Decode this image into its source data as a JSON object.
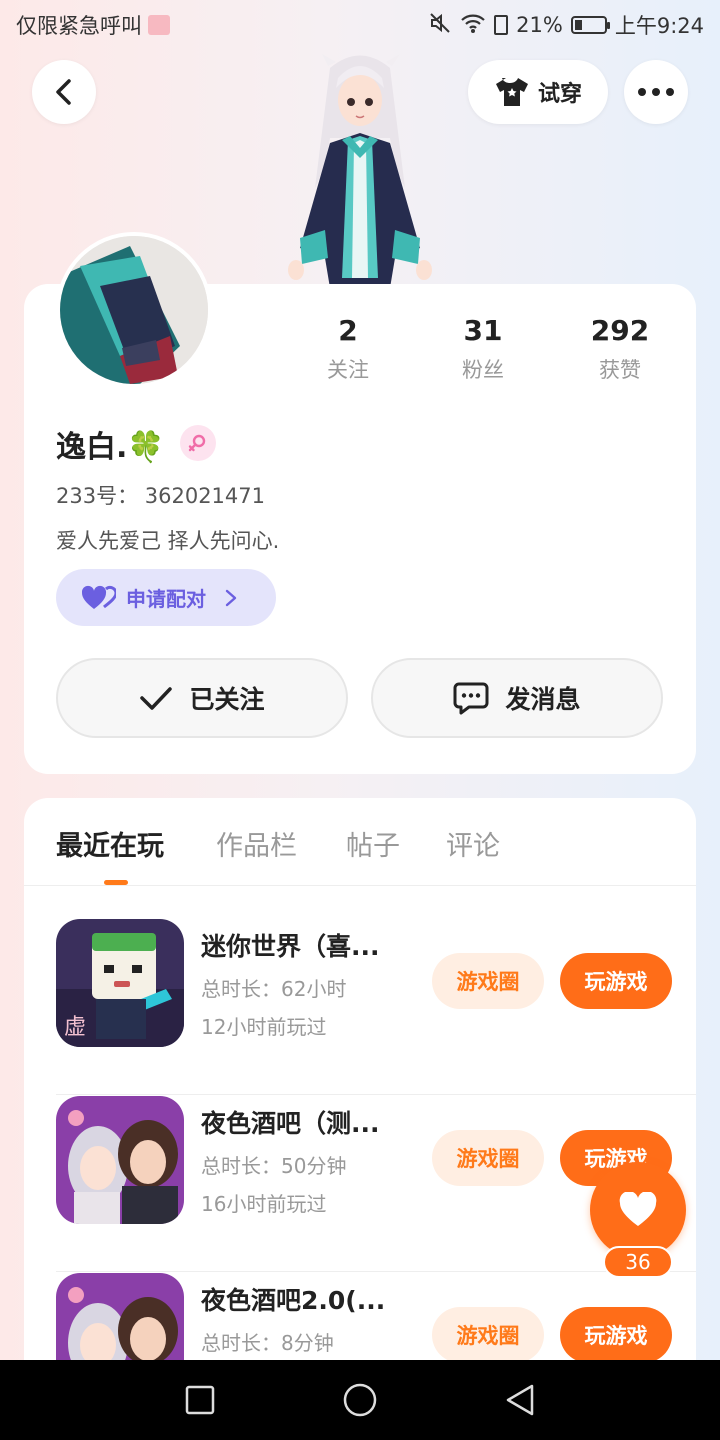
{
  "status_bar": {
    "left_text": "仅限紧急呼叫",
    "battery": "21%",
    "time": "上午9:24"
  },
  "header": {
    "try_on_label": "试穿"
  },
  "profile": {
    "stats": [
      {
        "value": "2",
        "label": "关注"
      },
      {
        "value": "31",
        "label": "粉丝"
      },
      {
        "value": "292",
        "label": "获赞"
      }
    ],
    "nickname": "逸白.🍀",
    "uid": "233号： 362021471",
    "bio": "爱人先爱己  择人先问心.",
    "pair_label": "申请配对",
    "follow_label": "已关注",
    "message_label": "发消息"
  },
  "tabs": [
    {
      "label": "最近在玩"
    },
    {
      "label": "作品栏"
    },
    {
      "label": "帖子"
    },
    {
      "label": "评论"
    }
  ],
  "games": [
    {
      "title": "迷你世界（喜...",
      "duration": "总时长：62小时",
      "last_played": "12小时前玩过",
      "circle_label": "游戏圈",
      "play_label": "玩游戏"
    },
    {
      "title": "夜色酒吧（测...",
      "duration": "总时长：50分钟",
      "last_played": "16小时前玩过",
      "circle_label": "游戏圈",
      "play_label": "玩游戏"
    },
    {
      "title": "夜色酒吧2.0(...",
      "duration": "总时长：8分钟",
      "last_played": "",
      "circle_label": "游戏圈",
      "play_label": "玩游戏"
    }
  ],
  "like": {
    "count": "36"
  },
  "colors": {
    "accent": "#ff6d18",
    "pair_purple": "#6b5fe0"
  }
}
